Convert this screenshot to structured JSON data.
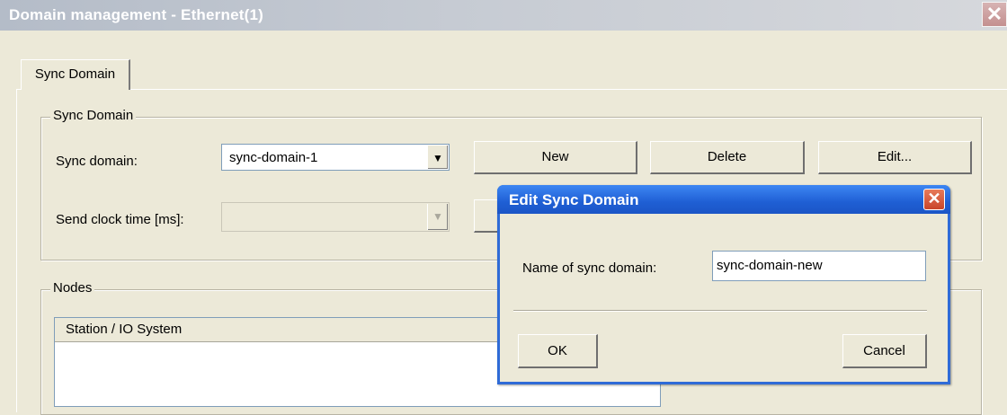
{
  "window": {
    "title": "Domain management - Ethernet(1)",
    "close_glyph": "✕"
  },
  "tabs": [
    {
      "label": "Sync Domain",
      "active": true
    }
  ],
  "sync_group": {
    "legend": "Sync Domain",
    "sync_domain_label": "Sync domain:",
    "sync_domain_value": "sync-domain-1",
    "send_clock_label": "Send clock time [ms]:",
    "send_clock_value": "",
    "new_button": "New",
    "delete_button": "Delete",
    "edit_button": "Edit..."
  },
  "nodes_group": {
    "legend": "Nodes",
    "columns": [
      "Station / IO System"
    ],
    "rows": []
  },
  "dialog": {
    "title": "Edit Sync Domain",
    "close_glyph": "✕",
    "name_label": "Name of sync domain:",
    "name_value": "sync-domain-new",
    "ok_button": "OK",
    "cancel_button": "Cancel"
  },
  "icons": {
    "dropdown": "chevron-down-icon",
    "close": "close-icon"
  },
  "colors": {
    "dialog_title_blue": "#2f6bd7",
    "close_red": "#c9452b",
    "face": "#ece9d8"
  }
}
